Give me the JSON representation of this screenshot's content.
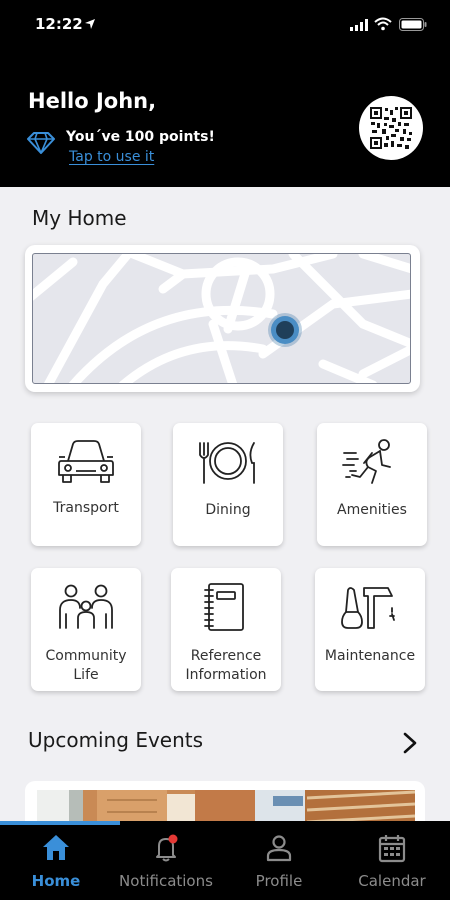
{
  "status": {
    "time": "12:22"
  },
  "header": {
    "greeting": "Hello John,",
    "points_text": "You´ve 100 points!",
    "tap_link": "Tap to use it"
  },
  "my_home": {
    "title": "My Home"
  },
  "services": [
    {
      "label": "Transport",
      "icon": "car-icon"
    },
    {
      "label": "Dining",
      "icon": "dining-icon"
    },
    {
      "label": "Amenities",
      "icon": "running-icon"
    },
    {
      "label": "Community Life",
      "icon": "family-icon"
    },
    {
      "label": "Reference Information",
      "icon": "notebook-icon"
    },
    {
      "label": "Maintenance",
      "icon": "tools-icon"
    }
  ],
  "events": {
    "title": "Upcoming Events"
  },
  "tabs": [
    {
      "label": "Home",
      "icon": "home-icon",
      "active": true
    },
    {
      "label": "Notifications",
      "icon": "bell-icon",
      "active": false
    },
    {
      "label": "Profile",
      "icon": "person-icon",
      "active": false
    },
    {
      "label": "Calendar",
      "icon": "calendar-icon",
      "active": false
    }
  ],
  "colors": {
    "accent": "#3a8fd9",
    "header_bg": "#000000",
    "map_marker": "#2e6e9e",
    "badge": "#e53935"
  }
}
